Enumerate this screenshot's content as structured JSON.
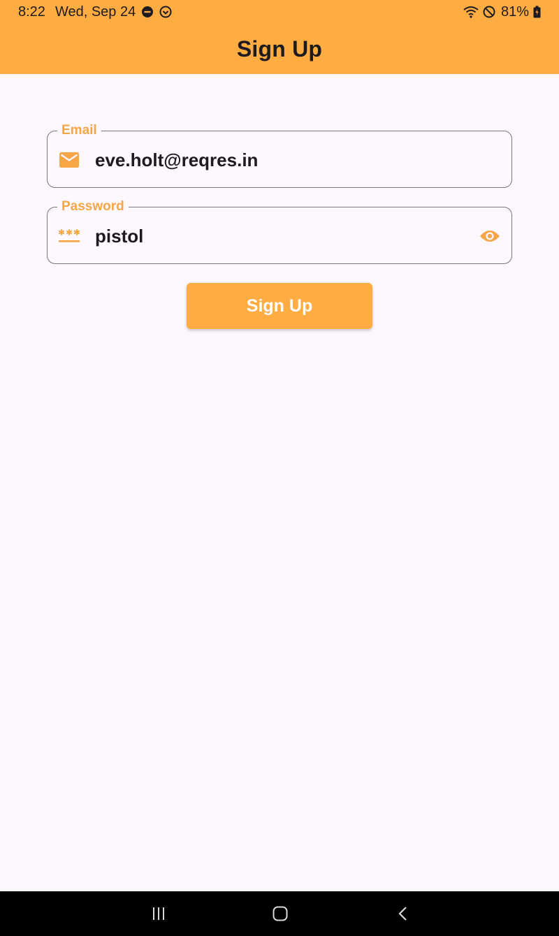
{
  "status_bar": {
    "time": "8:22",
    "date": "Wed, Sep 24",
    "battery": "81%",
    "icons": [
      "dnd-icon",
      "sync-icon",
      "wifi-icon",
      "blocked-icon",
      "battery-icon"
    ]
  },
  "app_bar": {
    "title": "Sign Up",
    "background": "#FFAD42"
  },
  "form": {
    "email": {
      "label": "Email",
      "value": "eve.holt@reqres.in",
      "icon": "mail-icon"
    },
    "password": {
      "label": "Password",
      "value": "pistol",
      "icon": "password-icon",
      "toggle_icon": "eye-icon"
    },
    "submit_label": "Sign Up",
    "accent": "#F6A646"
  },
  "nav_bar": {
    "icons": [
      "recent-apps-icon",
      "home-icon",
      "back-icon"
    ]
  }
}
